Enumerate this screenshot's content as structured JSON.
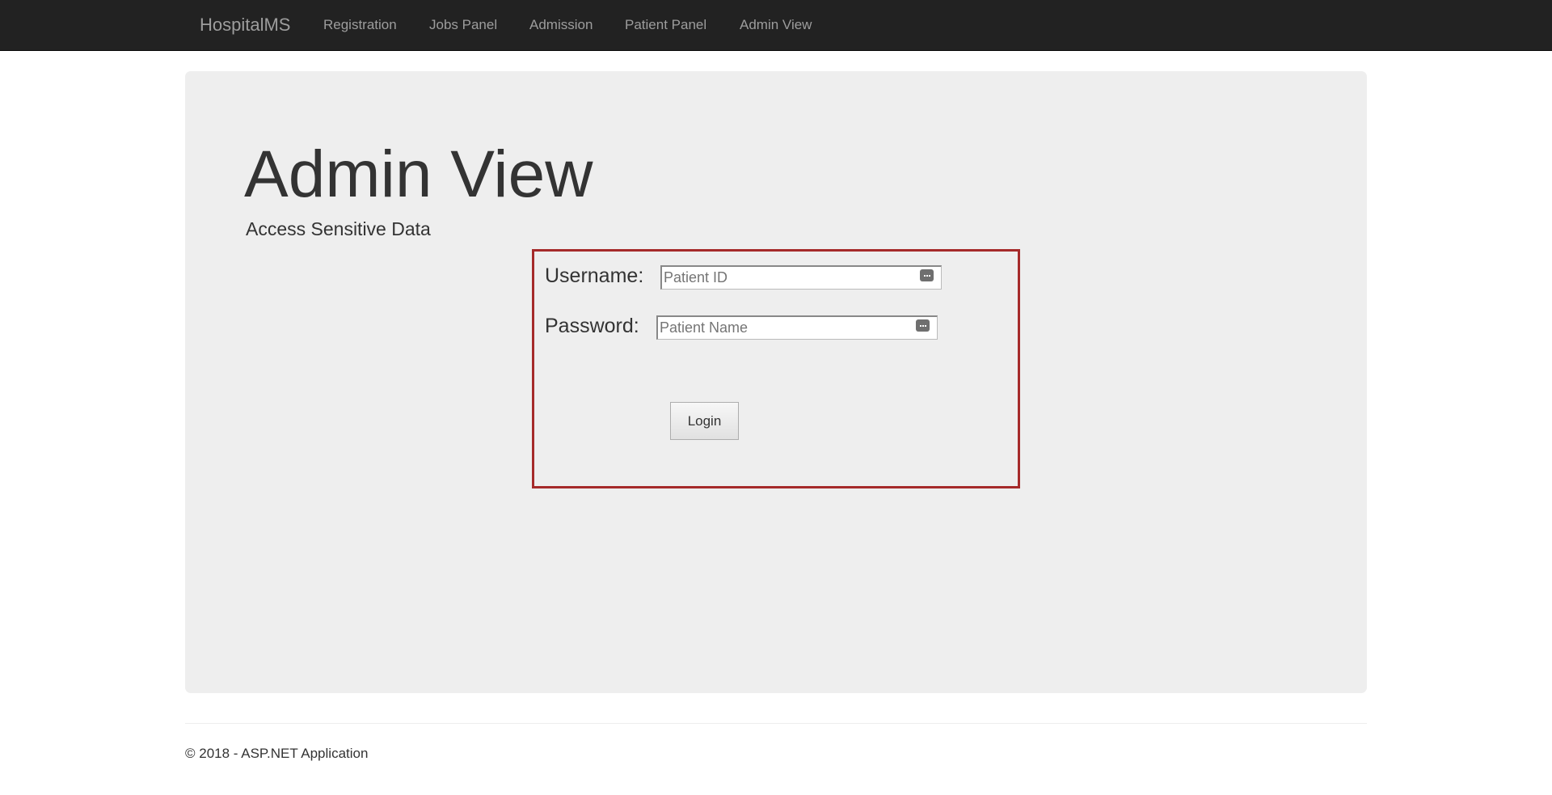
{
  "navbar": {
    "brand": "HospitalMS",
    "links": [
      "Registration",
      "Jobs Panel",
      "Admission",
      "Patient Panel",
      "Admin View"
    ]
  },
  "jumbotron": {
    "title": "Admin View",
    "lead": "Access Sensitive Data"
  },
  "login": {
    "username_label": "Username:",
    "username_placeholder": "Patient ID",
    "username_value": "",
    "password_label": "Password:",
    "password_placeholder": "Patient Name",
    "password_value": "",
    "button_label": "Login",
    "field_icon": "password-manager-key-icon"
  },
  "footer": {
    "text": "© 2018 - ASP.NET Application"
  },
  "colors": {
    "navbar_bg": "#222222",
    "nav_text": "#9d9d9d",
    "jumbotron_bg": "#eeeeee",
    "login_border": "#a52a2a"
  }
}
